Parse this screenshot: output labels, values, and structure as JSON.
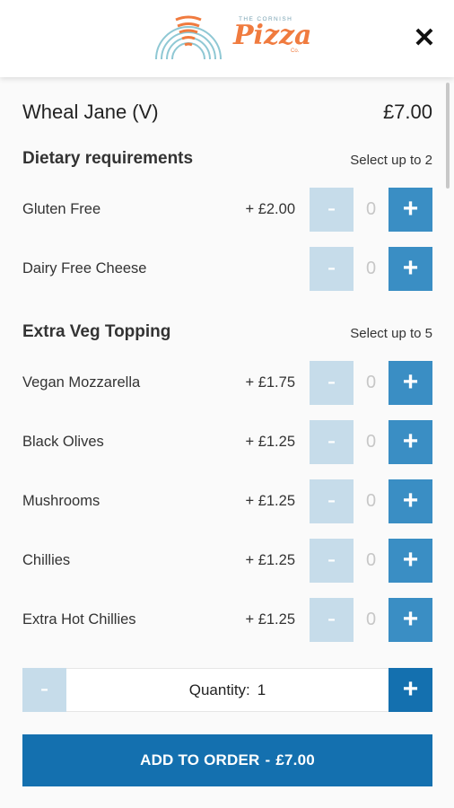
{
  "header": {
    "brand_top": "THE CORNISH",
    "brand_script": "Pizza",
    "brand_co": "Co.",
    "close_label": "✕"
  },
  "item": {
    "name": "Wheal Jane (V)",
    "price": "£7.00"
  },
  "sections": [
    {
      "heading": "Dietary requirements",
      "hint": "Select up to 2",
      "options": [
        {
          "label": "Gluten Free",
          "extra": "+ £2.00",
          "count": "0"
        },
        {
          "label": "Dairy Free Cheese",
          "extra": "",
          "count": "0"
        }
      ]
    },
    {
      "heading": "Extra Veg Topping",
      "hint": "Select up to 5",
      "options": [
        {
          "label": "Vegan Mozzarella",
          "extra": "+ £1.75",
          "count": "0"
        },
        {
          "label": "Black Olives",
          "extra": "+ £1.25",
          "count": "0"
        },
        {
          "label": "Mushrooms",
          "extra": "+ £1.25",
          "count": "0"
        },
        {
          "label": "Chillies",
          "extra": "+ £1.25",
          "count": "0"
        },
        {
          "label": "Extra Hot Chillies",
          "extra": "+ £1.25",
          "count": "0"
        }
      ]
    }
  ],
  "controls": {
    "minus": "-",
    "plus": "+"
  },
  "quantity": {
    "label": "Quantity:",
    "value": "1"
  },
  "add_button": {
    "label": "ADD TO ORDER",
    "separator": "-",
    "total": "£7.00"
  },
  "colors": {
    "accent": "#1470af",
    "plus_button": "#3a8ec4",
    "minus_disabled": "#c6dcea",
    "brand_orange": "#f07b3f",
    "brand_blue": "#8fc8d4"
  }
}
